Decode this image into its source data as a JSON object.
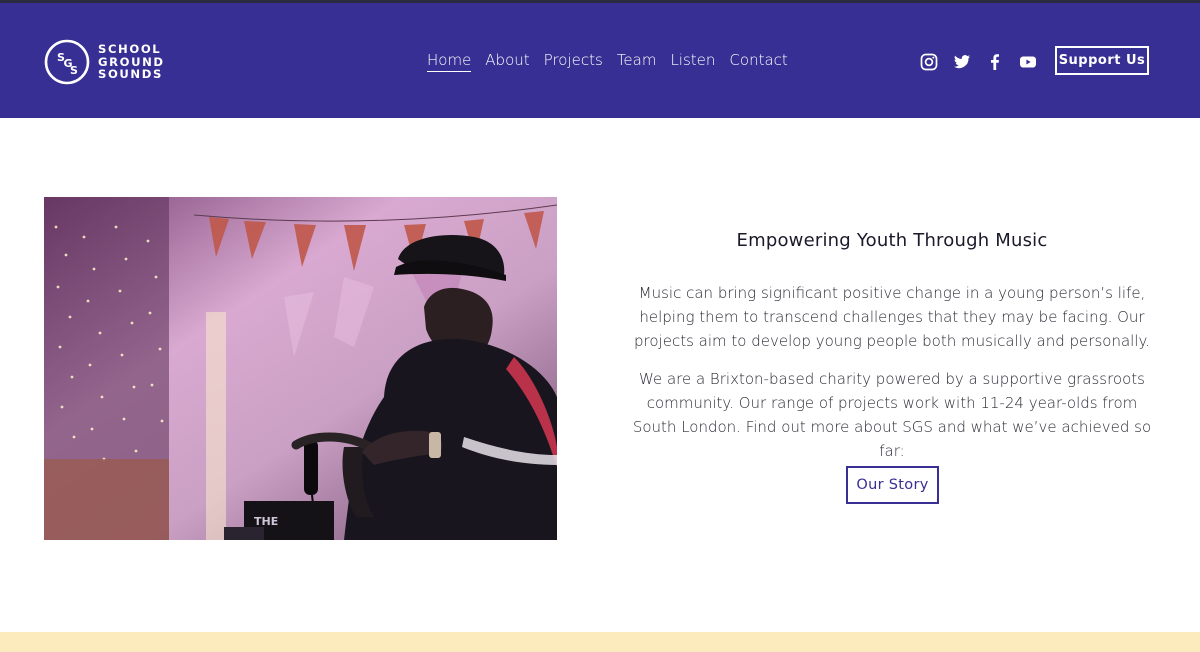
{
  "header": {
    "logo": {
      "monogram": "SGS",
      "lines": [
        "SCHOOL",
        "GROUND",
        "SOUNDS"
      ]
    },
    "nav": [
      {
        "label": "Home",
        "active": true
      },
      {
        "label": "About"
      },
      {
        "label": "Projects"
      },
      {
        "label": "Team"
      },
      {
        "label": "Listen"
      },
      {
        "label": "Contact"
      }
    ],
    "social_icons": [
      "instagram-icon",
      "twitter-icon",
      "facebook-icon",
      "youtube-icon"
    ],
    "support_label": "Support Us"
  },
  "main": {
    "title": "Empowering Youth Through Music",
    "paragraphs": [
      "Music can bring significant positive change in a young person’s life, helping them to transcend challenges that they may be facing. Our projects aim to develop young people both musically and personally.",
      "We are a Brixton-based charity powered by a supportive grassroots community. Our range of projects work with 11-24 year-olds from South London. Find out more about SGS and what we’ve achieved so far:"
    ],
    "cta_label": "Our Story"
  },
  "colors": {
    "header_bg": "#372f93",
    "accent": "#372f93",
    "footer_band": "#fcecbd"
  }
}
